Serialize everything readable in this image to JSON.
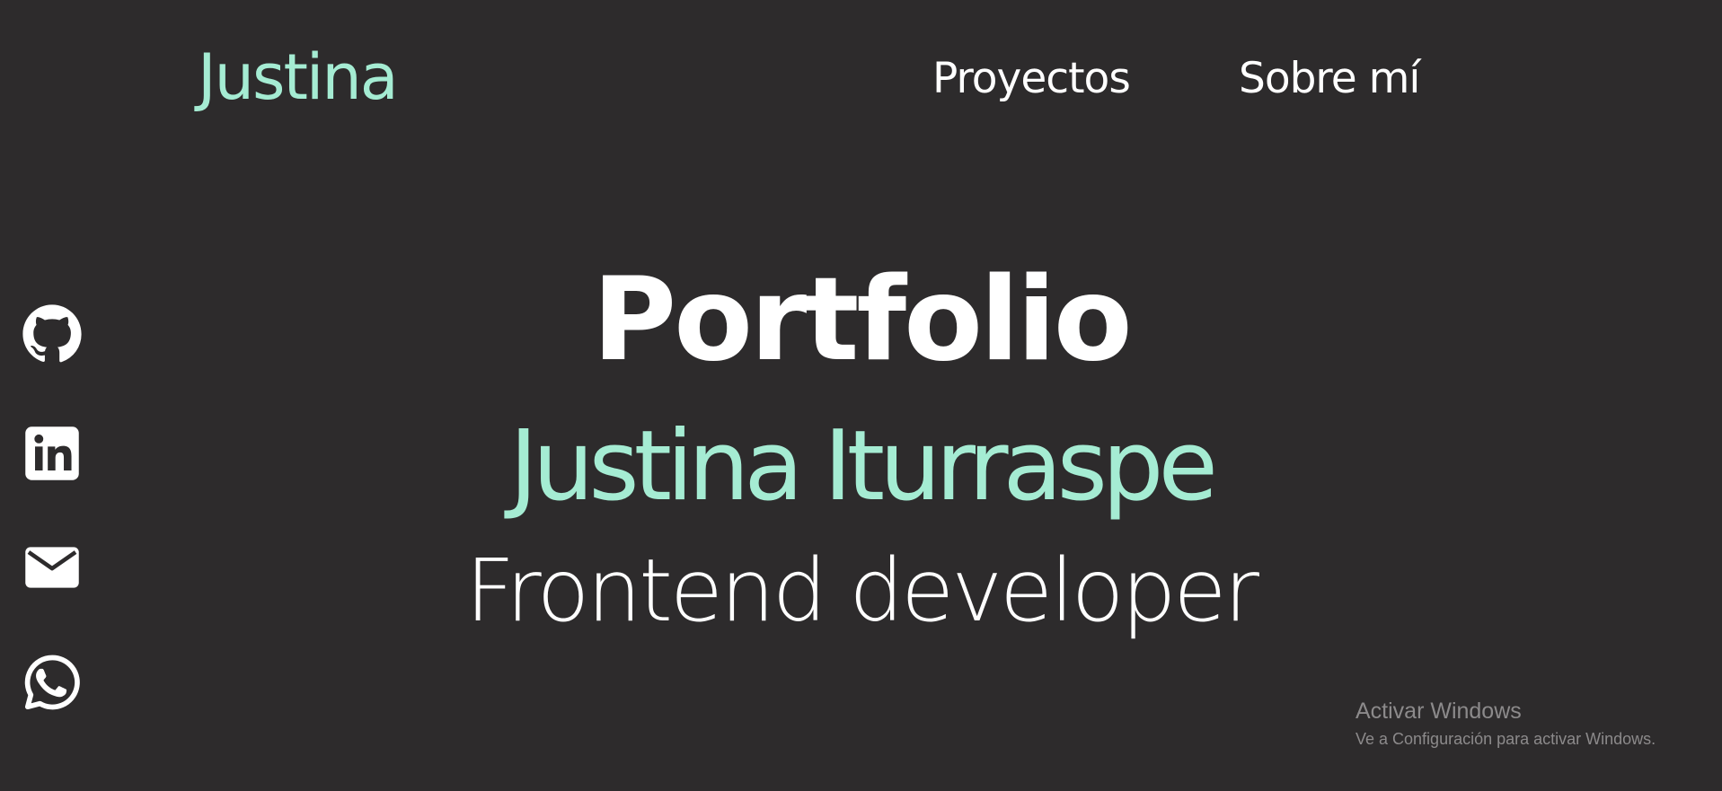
{
  "nav": {
    "logo": "Justina",
    "links": [
      {
        "label": "Proyectos"
      },
      {
        "label": "Sobre mí"
      }
    ]
  },
  "socials": [
    {
      "icon": "github-icon"
    },
    {
      "icon": "linkedin-icon"
    },
    {
      "icon": "mail-icon"
    },
    {
      "icon": "whatsapp-icon"
    }
  ],
  "hero": {
    "title": "Portfolio",
    "name": "Justina Iturraspe",
    "role": "Frontend developer"
  },
  "watermark": {
    "title": "Activar Windows",
    "subtitle": "Ve a Configuración para activar Windows."
  },
  "colors": {
    "background": "#2d2b2c",
    "accent": "#a5ecd3",
    "text": "#ffffff",
    "watermark": "#8c8a8b"
  }
}
